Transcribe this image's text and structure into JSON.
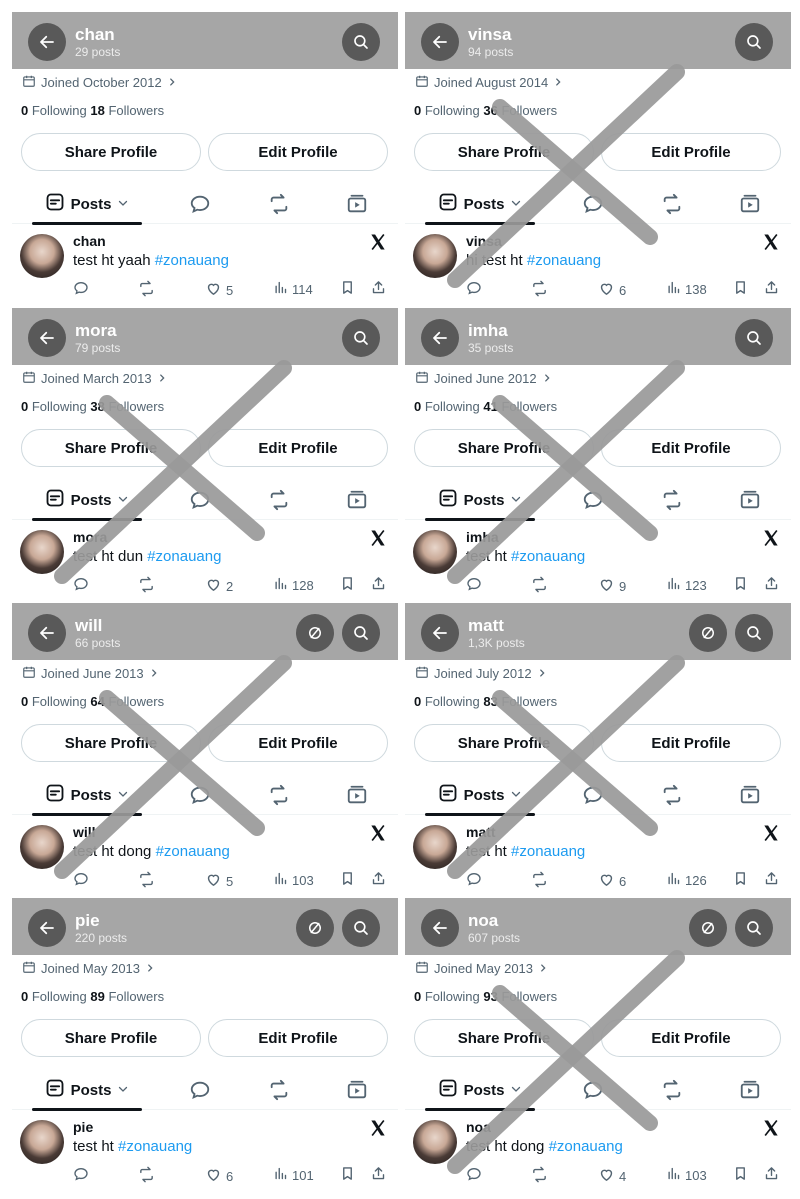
{
  "panels": [
    {
      "name": "chan",
      "posts": "29 posts",
      "joined": "Joined October 2012",
      "following": "0",
      "following_label": "Following",
      "followers": "18",
      "followers_label": "Followers",
      "share": "Share Profile",
      "edit": "Edit Profile",
      "tab_label": "Posts",
      "tweet_name": "chan",
      "tweet_text": "test ht yaah",
      "hashtag": "#zonauang",
      "likes": "5",
      "views": "114",
      "crossed": false,
      "extra_icon": false
    },
    {
      "name": "vinsa",
      "posts": "94 posts",
      "joined": "Joined August 2014",
      "following": "0",
      "following_label": "Following",
      "followers": "36",
      "followers_label": "Followers",
      "share": "Share Profile",
      "edit": "Edit Profile",
      "tab_label": "Posts",
      "tweet_name": "vinsa",
      "tweet_text": "hi test ht",
      "hashtag": "#zonauang",
      "likes": "6",
      "views": "138",
      "crossed": true,
      "extra_icon": false
    },
    {
      "name": "mora",
      "posts": "79 posts",
      "joined": "Joined March 2013",
      "following": "0",
      "following_label": "Following",
      "followers": "38",
      "followers_label": "Followers",
      "share": "Share Profile",
      "edit": "Edit Profile",
      "tab_label": "Posts",
      "tweet_name": "mora",
      "tweet_text": "test ht dun",
      "hashtag": "#zonauang",
      "likes": "2",
      "views": "128",
      "crossed": true,
      "extra_icon": false
    },
    {
      "name": "imha",
      "posts": "35 posts",
      "joined": "Joined June 2012",
      "following": "0",
      "following_label": "Following",
      "followers": "41",
      "followers_label": "Followers",
      "share": "Share Profile",
      "edit": "Edit Profile",
      "tab_label": "Posts",
      "tweet_name": "imha",
      "tweet_text": "test ht",
      "hashtag": "#zonauang",
      "likes": "9",
      "views": "123",
      "crossed": true,
      "extra_icon": false
    },
    {
      "name": "will",
      "posts": "66 posts",
      "joined": "Joined June 2013",
      "following": "0",
      "following_label": "Following",
      "followers": "64",
      "followers_label": "Followers",
      "share": "Share Profile",
      "edit": "Edit Profile",
      "tab_label": "Posts",
      "tweet_name": "will",
      "tweet_text": "test ht dong",
      "hashtag": "#zonauang",
      "likes": "5",
      "views": "103",
      "crossed": true,
      "extra_icon": true
    },
    {
      "name": "matt",
      "posts": "1,3K posts",
      "joined": "Joined July 2012",
      "following": "0",
      "following_label": "Following",
      "followers": "83",
      "followers_label": "Followers",
      "share": "Share Profile",
      "edit": "Edit Profile",
      "tab_label": "Posts",
      "tweet_name": "matt",
      "tweet_text": "test ht",
      "hashtag": "#zonauang",
      "likes": "6",
      "views": "126",
      "crossed": true,
      "extra_icon": true
    },
    {
      "name": "pie",
      "posts": "220 posts",
      "joined": "Joined May 2013",
      "following": "0",
      "following_label": "Following",
      "followers": "89",
      "followers_label": "Followers",
      "share": "Share Profile",
      "edit": "Edit Profile",
      "tab_label": "Posts",
      "tweet_name": "pie",
      "tweet_text": "test ht",
      "hashtag": "#zonauang",
      "likes": "6",
      "views": "101",
      "crossed": false,
      "extra_icon": true
    },
    {
      "name": "noa",
      "posts": "607 posts",
      "joined": "Joined May 2013",
      "following": "0",
      "following_label": "Following",
      "followers": "93",
      "followers_label": "Followers",
      "share": "Share Profile",
      "edit": "Edit Profile",
      "tab_label": "Posts",
      "tweet_name": "noa",
      "tweet_text": "test ht dong",
      "hashtag": "#zonauang",
      "likes": "4",
      "views": "103",
      "crossed": true,
      "extra_icon": true
    }
  ],
  "colors": {
    "header": "#a6a6a6",
    "header_button": "#595959",
    "hashtag": "#1d9bf0",
    "cross": "#9a9a9a"
  }
}
